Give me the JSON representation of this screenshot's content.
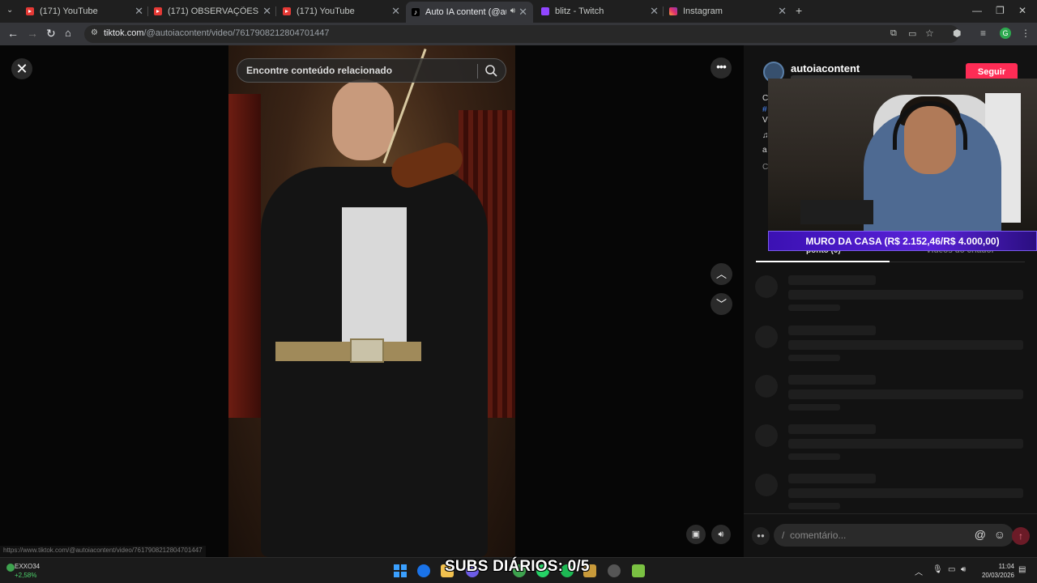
{
  "browser": {
    "tabs": [
      {
        "title": "(171) YouTube",
        "favicon": "youtube-icon",
        "active": false
      },
      {
        "title": "(171) OBSERVAÇÕES DIÁRIAS (",
        "favicon": "youtube-icon",
        "active": false
      },
      {
        "title": "(171) YouTube",
        "favicon": "youtube-icon",
        "active": false
      },
      {
        "title": "Auto IA content (@autoiac",
        "favicon": "tiktok-icon",
        "active": true
      },
      {
        "title": "blitz - Twitch",
        "favicon": "twitch-icon",
        "active": false
      },
      {
        "title": "Instagram",
        "favicon": "instagram-icon",
        "active": false
      }
    ],
    "url_host": "tiktok.com",
    "url_path": "/@autoiacontent/video/7617908212804701447",
    "profile_initial": "G"
  },
  "video_view": {
    "search_placeholder": "Encontre conteúdo relacionado",
    "status_url": "https://www.tiktok.com/@autoiacontent/video/7617908212804701447"
  },
  "panel": {
    "username": "autoiacontent",
    "follow_label": "Seguir",
    "desc_fragments": [
      "C",
      "#",
      "V",
      "♫",
      "a",
      "C"
    ],
    "tabs": [
      {
        "label": "ponto (0)"
      },
      {
        "label": "Vídeos do criador"
      }
    ],
    "comment_placeholder": "comentário...",
    "comment_slash": "/"
  },
  "stream_overlay": {
    "goal_text": "MURO DA CASA (R$ 2.152,46/R$ 4.000,00)",
    "subs_text": "SUBS DIÁRIOS: 0/5"
  },
  "taskbar": {
    "stock_name": "EXXO34",
    "stock_change": "+2,58%",
    "time": "11:04",
    "date": "20/03/2026"
  },
  "colors": {
    "follow_bg": "#fe2c55",
    "goal_bg": "#4a18c8"
  }
}
